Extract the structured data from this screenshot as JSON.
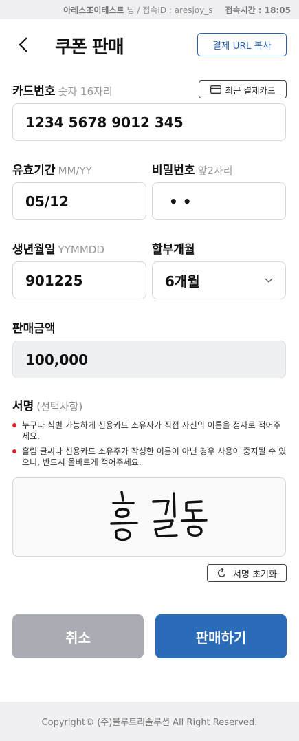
{
  "topbar": {
    "company": "아레스조이테스트",
    "suffix": "님 / 접속ID : aresjoy_s",
    "time_label": "접속시간 : 18:05"
  },
  "header": {
    "title": "쿠폰 판매",
    "copy_url_label": "결제 URL 복사"
  },
  "card_number": {
    "label": "카드번호",
    "hint": "숫자 16자리",
    "value": "1234 5678 9012 345",
    "recent_label": "최근 결제카드"
  },
  "expiry": {
    "label": "유효기간",
    "hint": "MM/YY",
    "value": "05/12"
  },
  "password": {
    "label": "비밀번호",
    "hint": "앞2자리",
    "value": "• •"
  },
  "birth": {
    "label": "생년월일",
    "hint": "YYMMDD",
    "value": "901225"
  },
  "installment": {
    "label": "할부개월",
    "value": "6개월"
  },
  "amount": {
    "label": "판매금액",
    "value": "100,000"
  },
  "signature": {
    "label": "서명",
    "hint": "(선택사항)",
    "notes": [
      "누구나 식별 가능하게 신용카드 소유자가 직접 자신의 이름을 정자로 적어주세요.",
      "흘림 글씨나 신용카드 소유주가 작성한 이름이 아닌 경우 사용이 중지될 수 있으니, 반드시 올바르게 적어주세요."
    ],
    "reset_label": "서명 초기화"
  },
  "actions": {
    "cancel": "취소",
    "sell": "판매하기"
  },
  "footer": "Copyright© (주)블루트리솔루션 All Right Reserved.",
  "colors": {
    "primary": "#2a6cb8",
    "cancel": "#a9adb3",
    "bullet": "#e0202a"
  }
}
